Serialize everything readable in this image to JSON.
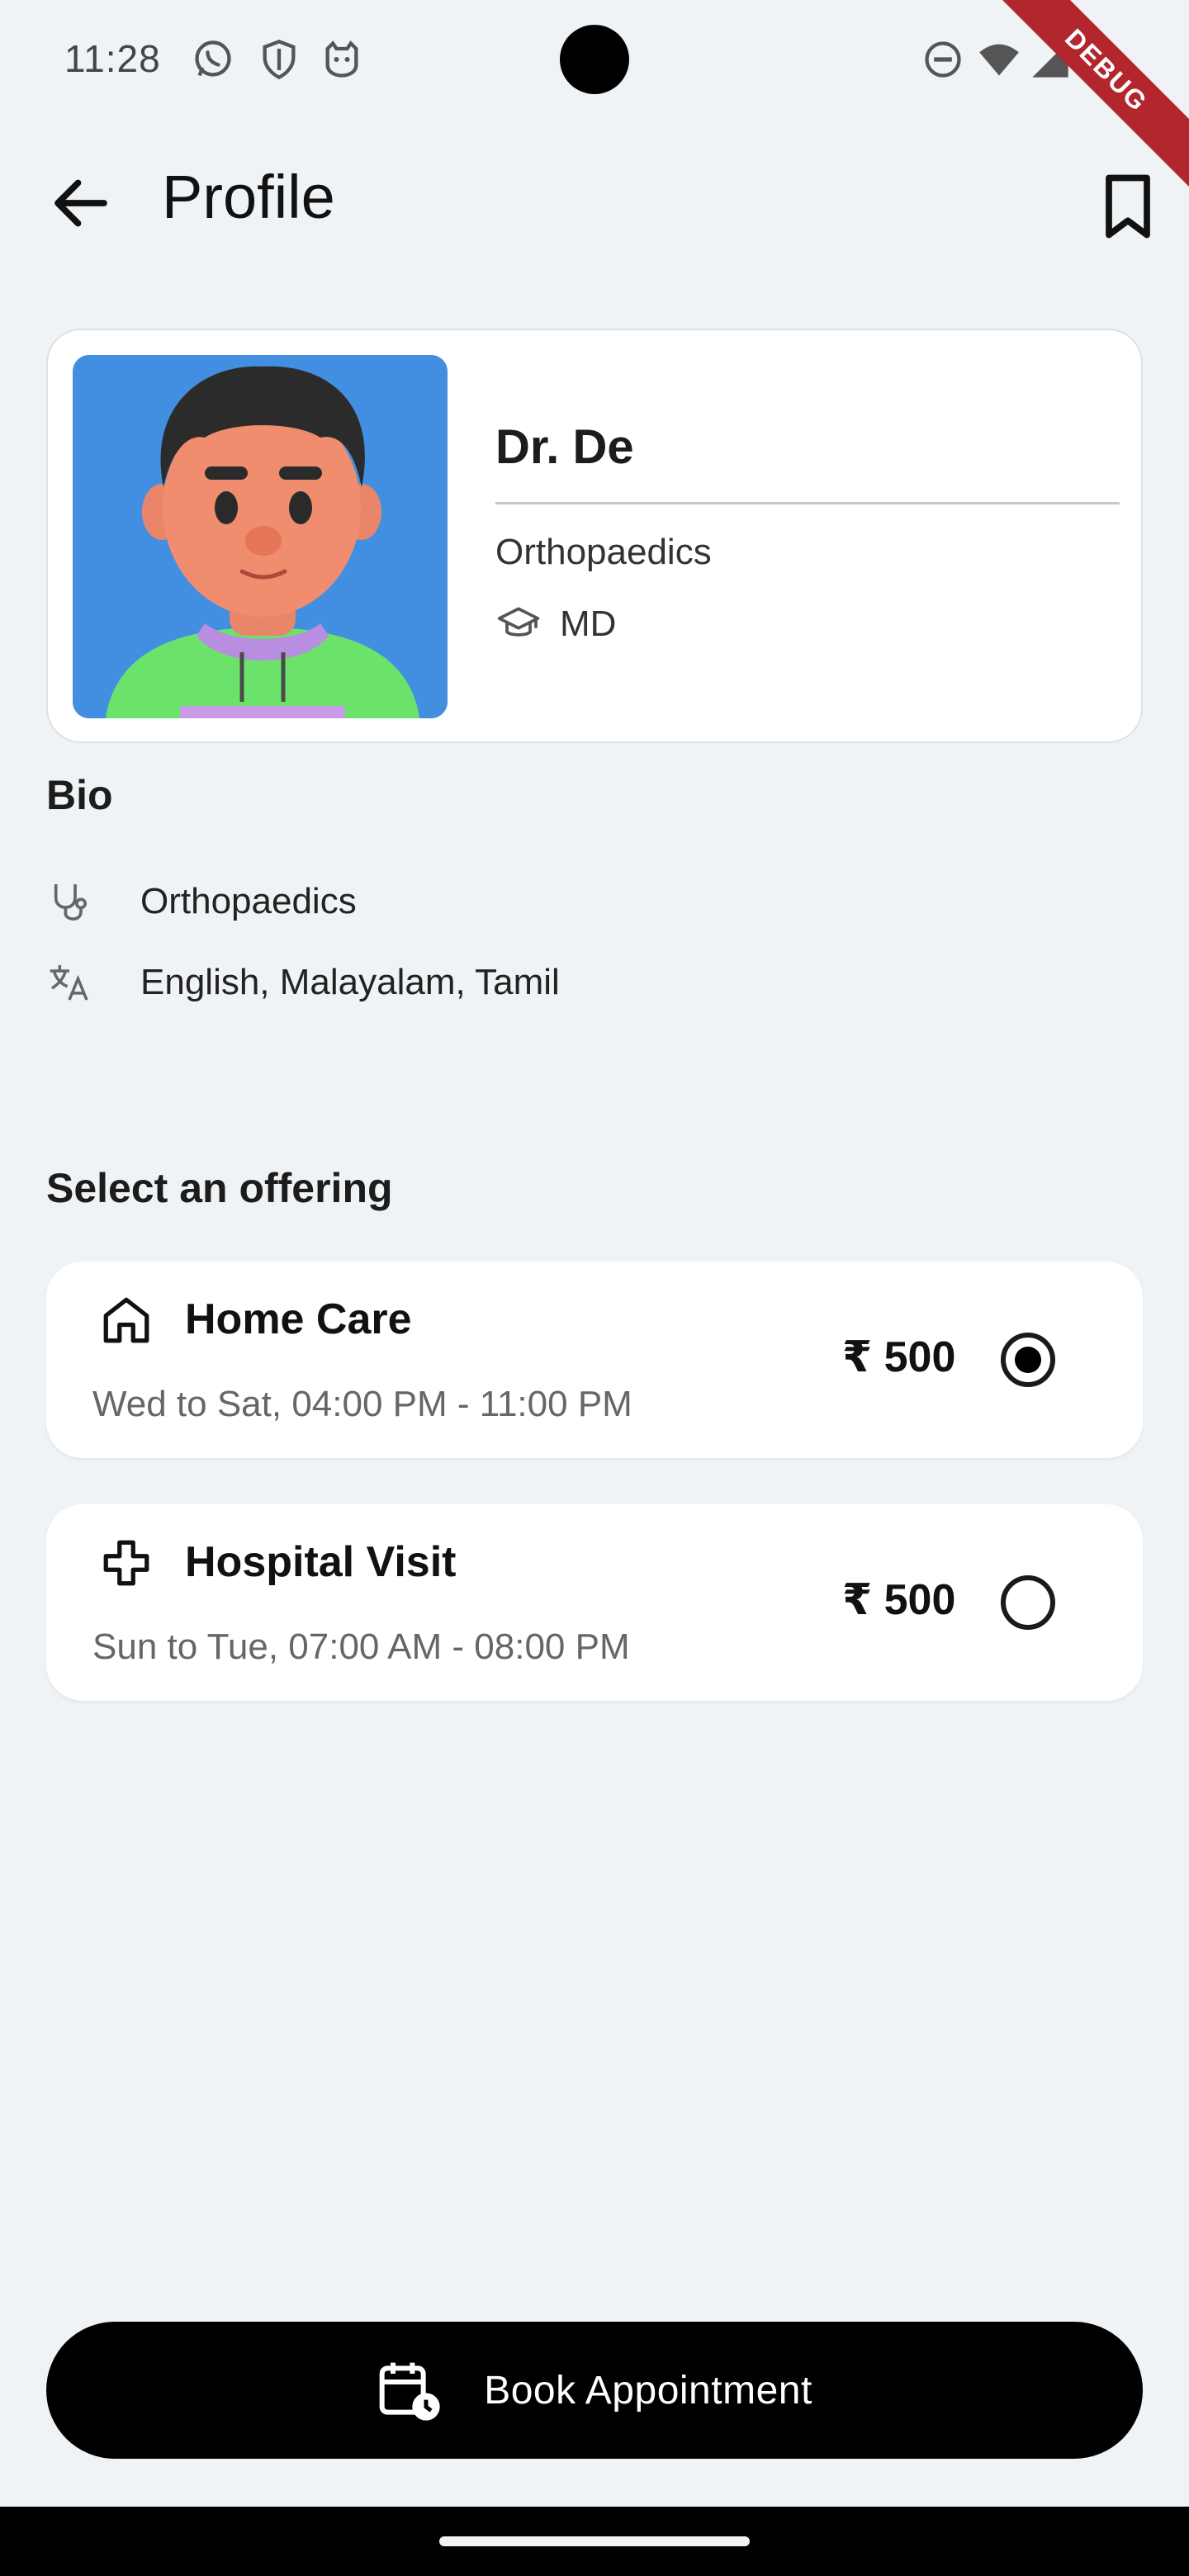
{
  "status_bar": {
    "time": "11:28",
    "left_icons": [
      "whatsapp-icon",
      "shield-icon",
      "cat-icon"
    ],
    "right_icons": [
      "do-not-disturb-icon",
      "wifi-icon",
      "signal-icon",
      "battery-icon"
    ],
    "debug_label": "DEBUG"
  },
  "app_bar": {
    "title": "Profile",
    "back_icon": "arrow-back-icon",
    "bookmark_icon": "bookmark-outline-icon"
  },
  "profile": {
    "name": "Dr. De",
    "specialty": "Orthopaedics",
    "degree": "MD",
    "degree_icon": "graduation-cap-icon",
    "avatar_background": "#428fe1"
  },
  "bio": {
    "heading": "Bio",
    "items": [
      {
        "icon": "stethoscope-icon",
        "text": "Orthopaedics"
      },
      {
        "icon": "translate-icon",
        "text": "English, Malayalam, Tamil"
      }
    ]
  },
  "offerings": {
    "heading": "Select an offering",
    "items": [
      {
        "icon": "home-icon",
        "title": "Home Care",
        "schedule": "Wed to Sat, 04:00 PM - 11:00 PM",
        "price": "₹ 500",
        "selected": true
      },
      {
        "icon": "medical-cross-icon",
        "title": "Hospital Visit",
        "schedule": "Sun to Tue, 07:00 AM - 08:00 PM",
        "price": "₹ 500",
        "selected": false
      }
    ]
  },
  "actions": {
    "book_label": "Book Appointment",
    "book_icon": "calendar-clock-icon"
  },
  "colors": {
    "background": "#eff3f5",
    "card": "#ffffff",
    "primary": "#000000",
    "debug_ribbon": "#b3262e"
  }
}
